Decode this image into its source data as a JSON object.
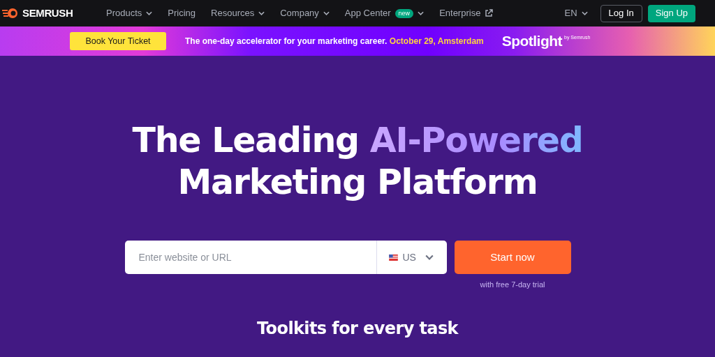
{
  "nav": {
    "logo": "SEMRUSH",
    "items": [
      {
        "label": "Products",
        "kind": "menu"
      },
      {
        "label": "Pricing",
        "kind": "link"
      },
      {
        "label": "Resources",
        "kind": "menu"
      },
      {
        "label": "Company",
        "kind": "menu"
      },
      {
        "label": "App Center",
        "kind": "menu",
        "badge": "new"
      },
      {
        "label": "Enterprise",
        "kind": "external"
      }
    ],
    "language": "EN",
    "login": "Log In",
    "signup": "Sign Up"
  },
  "banner": {
    "button": "Book Your Ticket",
    "text": "The one-day accelerator for your marketing career.",
    "date": "October 29, Amsterdam",
    "brand": "Spotlight",
    "brand_by": "by Semrush"
  },
  "hero": {
    "title_start": "The Leading",
    "title_highlight": "AI-Powered",
    "title_end": "Marketing Platform",
    "search": {
      "placeholder": "Enter website or URL",
      "country": "US"
    },
    "cta": "Start now",
    "cta_note": "with free 7-day trial",
    "subheading": "Toolkits for every task"
  }
}
